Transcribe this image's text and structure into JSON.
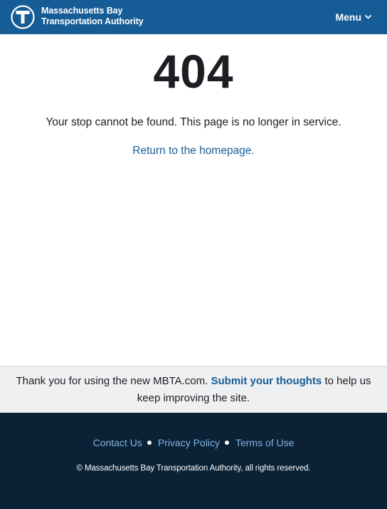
{
  "header": {
    "brand_line1": "Massachusetts Bay",
    "brand_line2": "Transportation Authority",
    "logo_icon": "mbta-t-logo-icon",
    "menu_label": "Menu",
    "menu_icon": "chevron-down-icon"
  },
  "main": {
    "error_code": "404",
    "message": "Your stop cannot be found. This page is no longer in service.",
    "home_link": "Return to the homepage."
  },
  "feedback": {
    "text_before": "Thank you for using the new MBTA.com. ",
    "link": "Submit your thoughts",
    "text_after": " to help us keep improving the site."
  },
  "footer": {
    "links": [
      "Contact Us",
      "Privacy Policy",
      "Terms of Use"
    ],
    "copyright": "© Massachusetts Bay Transportation Authority, all rights reserved."
  },
  "colors": {
    "header_bg": "#165c96",
    "link": "#165c96",
    "feedback_bg": "#eef0f1",
    "footer_bg": "#0b2136",
    "footer_link": "#80b2e0"
  }
}
